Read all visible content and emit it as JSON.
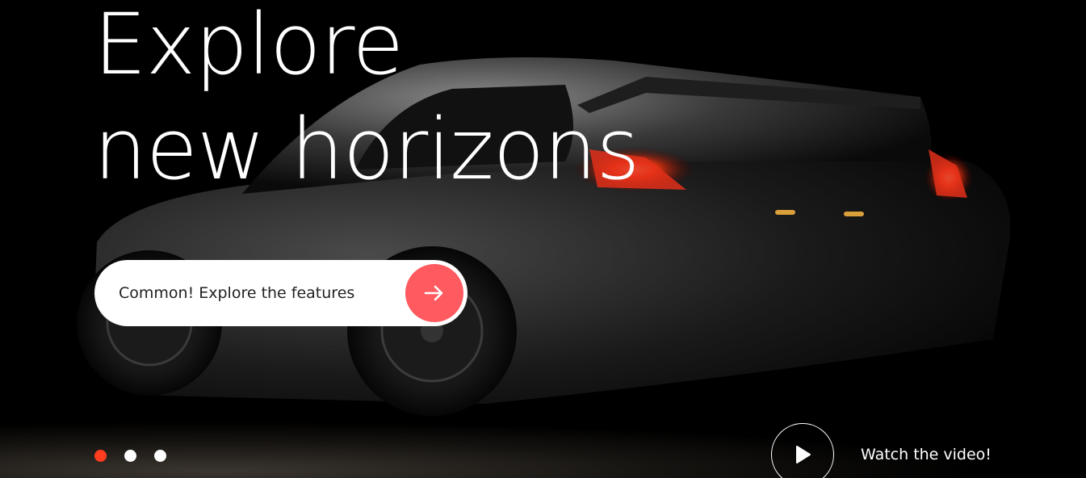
{
  "hero": {
    "headline_line1": "Explore",
    "headline_line2": "new horizons",
    "cta_label": "Common! Explore the features",
    "video_label": "Watch the video!"
  },
  "slider": {
    "dot_count": 3,
    "active_index": 0
  },
  "colors": {
    "accent": "#ff5a5f",
    "active_dot": "#ff3d1f",
    "background": "#000000",
    "text": "#ffffff"
  },
  "icons": {
    "cta": "arrow-right-icon",
    "video": "play-icon"
  }
}
